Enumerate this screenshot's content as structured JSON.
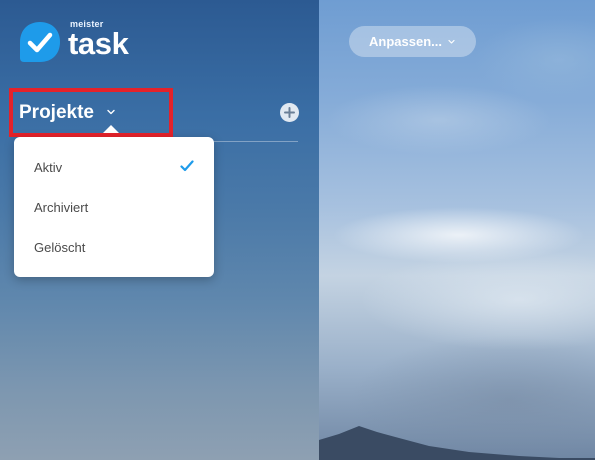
{
  "logo": {
    "sub": "meister",
    "main": "task"
  },
  "sidebar": {
    "section_title": "Projekte",
    "add_button_icon": "plus-icon",
    "dropdown": {
      "items": [
        {
          "label": "Aktiv",
          "selected": true
        },
        {
          "label": "Archiviert",
          "selected": false
        },
        {
          "label": "Gelöscht",
          "selected": false
        }
      ]
    }
  },
  "toolbar": {
    "customize_label": "Anpassen..."
  },
  "colors": {
    "accent": "#1e9bea",
    "highlight_border": "#e4222a"
  }
}
